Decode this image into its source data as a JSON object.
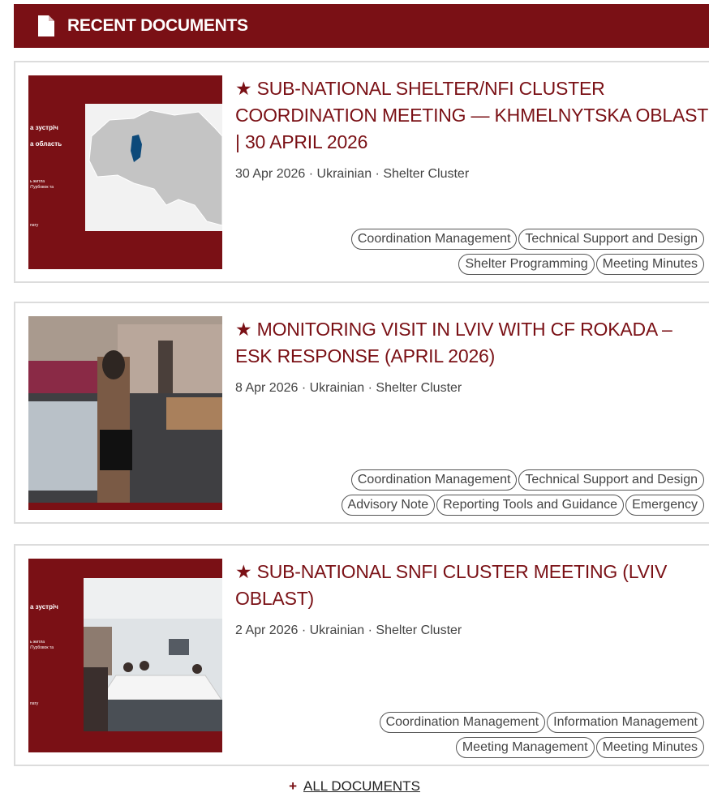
{
  "header": {
    "title": "RECENT DOCUMENTS",
    "icon": "document-icon"
  },
  "documents": [
    {
      "title": "★ SUB-NATIONAL SHELTER/NFI CLUSTER COORDINATION MEETING — KHMELNYTSKA OBLAST | 30 APRIL 2026",
      "meta": "30 Apr 2026 · Ukrainian · Shelter Cluster",
      "tags": [
        "Coordination Management",
        "Technical Support and Design",
        "Shelter Programming",
        "Meeting Minutes"
      ],
      "thumb": {
        "line1": "а зустріч",
        "line2": "а область",
        "line3": "ь житла",
        "line4": "/Турбовок та",
        "line5": "пату"
      }
    },
    {
      "title": "★ MONITORING VISIT IN LVIV WITH CF ROKADA – ESK RESPONSE (APRIL 2026)",
      "meta": "8 Apr 2026 · Ukrainian · Shelter Cluster",
      "tags": [
        "Coordination Management",
        "Technical Support and Design",
        "Advisory Note",
        "Reporting Tools and Guidance",
        "Emergency"
      ]
    },
    {
      "title": "★ SUB-NATIONAL SNFI CLUSTER MEETING (LVIV OBLAST)",
      "meta": "2 Apr 2026 · Ukrainian · Shelter Cluster",
      "tags": [
        "Coordination Management",
        "Information Management",
        "Meeting Management",
        "Meeting Minutes"
      ],
      "thumb": {
        "line1": "а зустріч",
        "line2": "ь житла",
        "line3": "/Турбовок та",
        "line4": "пату"
      }
    }
  ],
  "footer": {
    "plus": "+",
    "link_label": "ALL DOCUMENTS"
  },
  "colors": {
    "brand": "#7a1015",
    "border": "#dcdcdc",
    "map_highlight": "#0d4a7a"
  }
}
